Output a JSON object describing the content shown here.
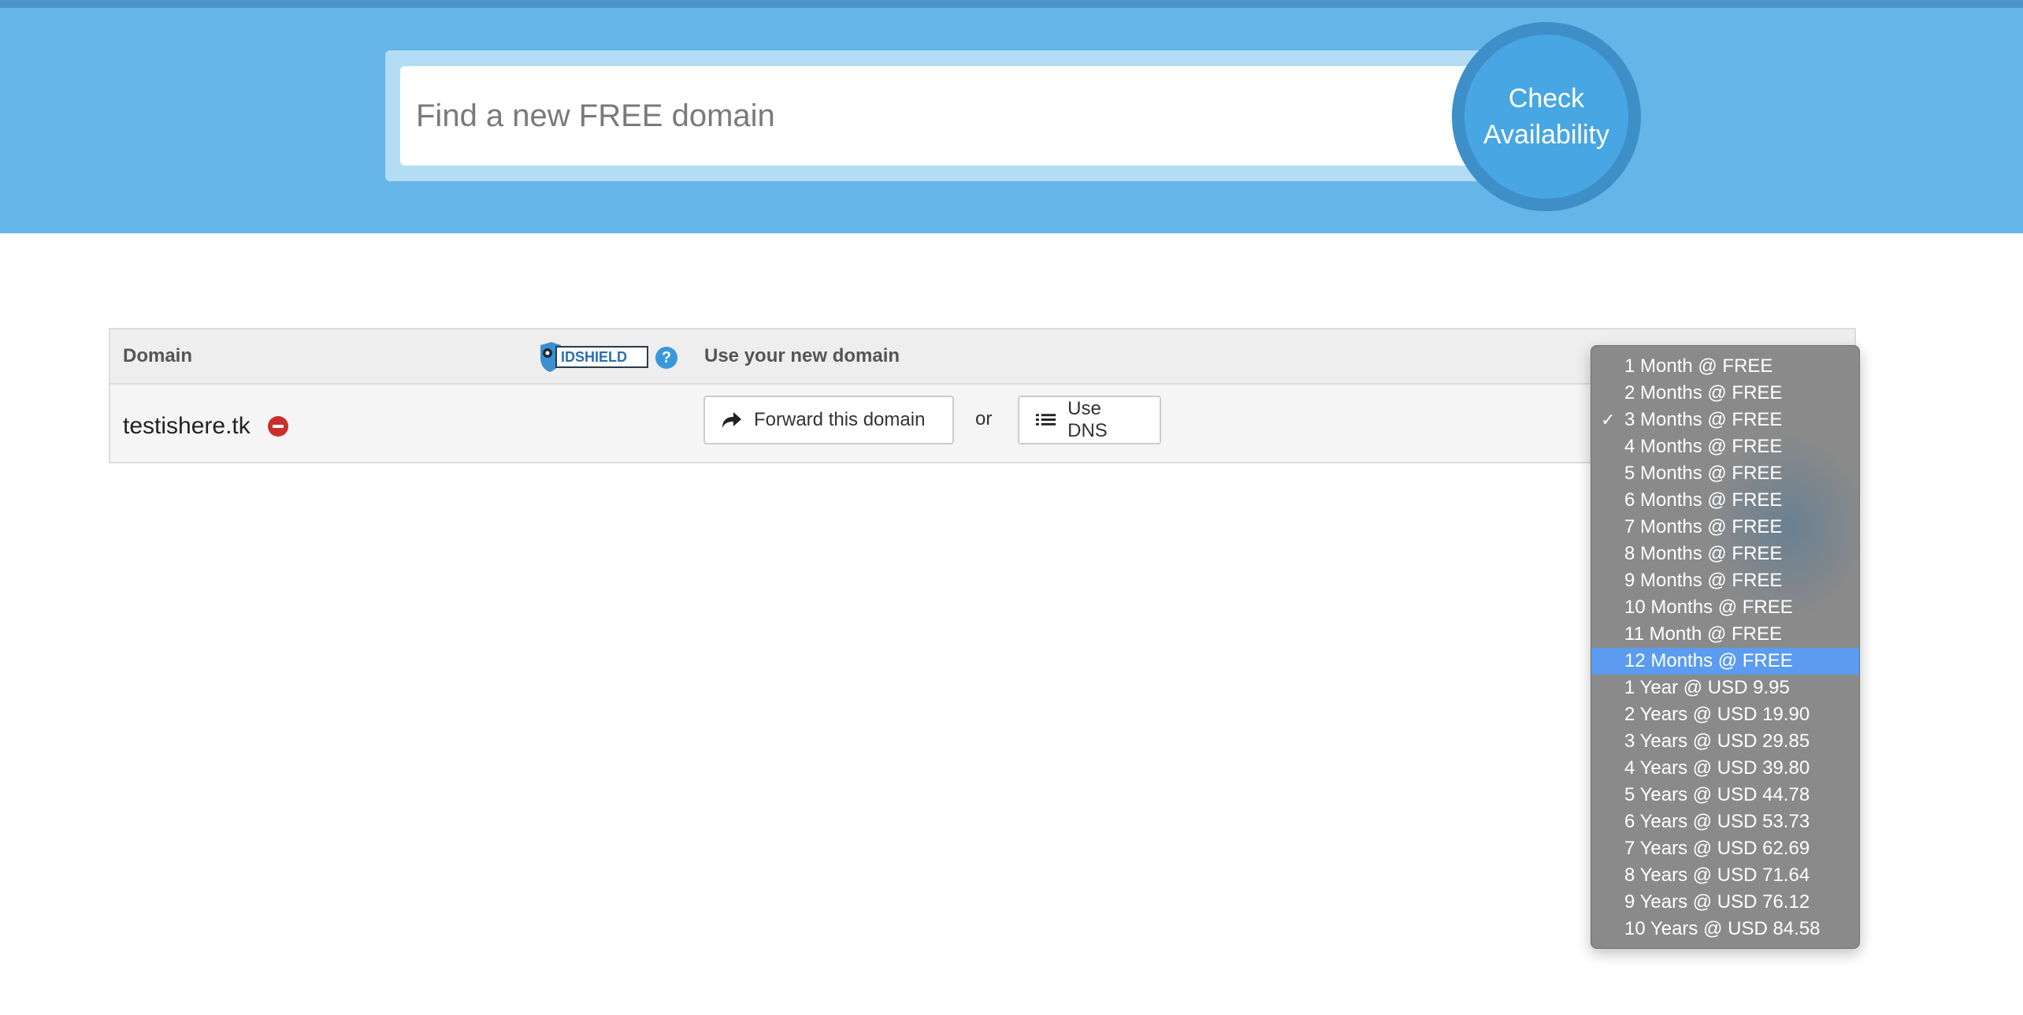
{
  "search": {
    "placeholder": "Find a new FREE domain",
    "button_label": "Check\nAvailability"
  },
  "table": {
    "headers": {
      "domain": "Domain",
      "use": "Use your new domain"
    },
    "idshield_logo_text": "IDSHIELD",
    "help_icon_glyph": "?",
    "row": {
      "domain": "testishere.tk",
      "forward_label": "Forward this domain",
      "or_label": "or",
      "dns_label": "Use DNS"
    }
  },
  "period_dropdown": {
    "selected_index": 2,
    "highlighted_index": 11,
    "options": [
      "1 Month @ FREE",
      "2 Months @ FREE",
      "3 Months @ FREE",
      "4 Months @ FREE",
      "5 Months @ FREE",
      "6 Months @ FREE",
      "7 Months @ FREE",
      "8 Months @ FREE",
      "9 Months @ FREE",
      "10 Months @ FREE",
      "11 Month @ FREE",
      "12 Months @ FREE",
      "1 Year @ USD 9.95",
      "2 Years @ USD 19.90",
      "3 Years @ USD 29.85",
      "4 Years @ USD 39.80",
      "5 Years @ USD 44.78",
      "6 Years @ USD 53.73",
      "7 Years @ USD 62.69",
      "8 Years @ USD 71.64",
      "9 Years @ USD 76.12",
      "10 Years @ USD 84.58"
    ]
  },
  "colors": {
    "hero": "#66b5e9",
    "check_button": "#48a6e3",
    "remove_icon": "#c9302c",
    "highlight": "#5b9bf0"
  }
}
